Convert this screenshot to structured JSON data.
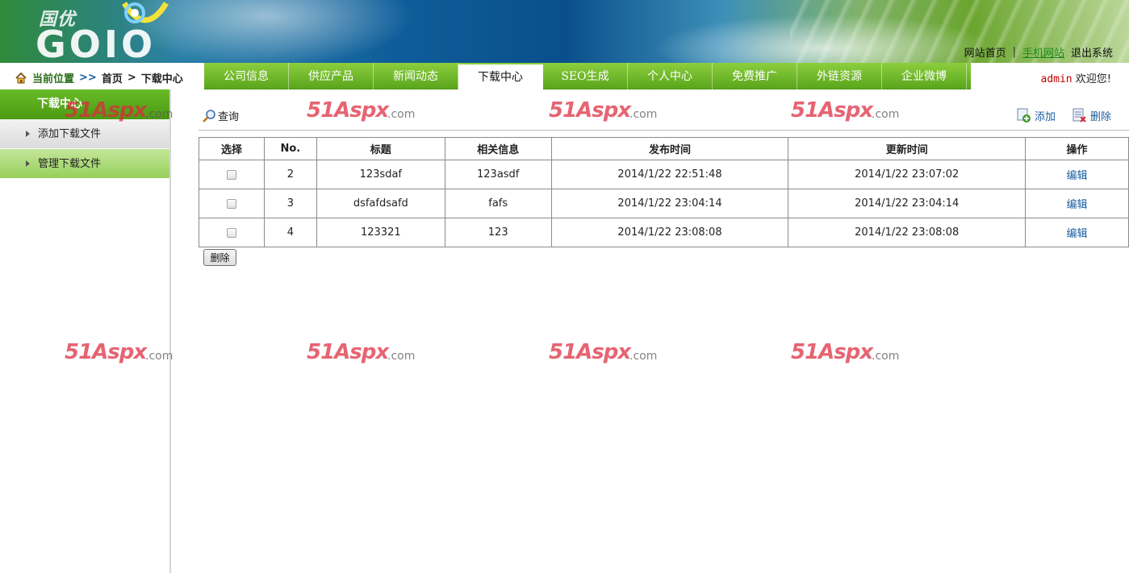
{
  "header": {
    "logo_cn": "国优",
    "logo_en": "GOIO",
    "links": [
      "网站首页",
      "手机网站",
      "退出系统"
    ],
    "separator": "|"
  },
  "breadcrumb": {
    "label": "当前位置",
    "arrow": ">>",
    "home": "首页",
    "sep": ">",
    "current": "下载中心"
  },
  "menu": {
    "items": [
      "公司信息",
      "供应产品",
      "新闻动态",
      "下载中心",
      "SEO生成",
      "个人中心",
      "免费推广",
      "外链资源",
      "企业微博"
    ],
    "active": "下载中心"
  },
  "welcome": {
    "user": "admin",
    "text": "欢迎您!"
  },
  "sidebar": {
    "title": "下载中心",
    "items": [
      "添加下载文件",
      "管理下载文件"
    ]
  },
  "toolbar": {
    "query": "查询",
    "add": "添加",
    "delete": "删除"
  },
  "table": {
    "headers": [
      "选择",
      "No.",
      "标题",
      "相关信息",
      "发布时间",
      "更新时间",
      "操作"
    ],
    "rows": [
      {
        "no": "2",
        "title": "123sdaf",
        "info": "123asdf",
        "published": "2014/1/22 22:51:48",
        "updated": "2014/1/22 23:07:02",
        "action": "编辑"
      },
      {
        "no": "3",
        "title": "dsfafdsafd",
        "info": "fafs",
        "published": "2014/1/22 23:04:14",
        "updated": "2014/1/22 23:04:14",
        "action": "编辑"
      },
      {
        "no": "4",
        "title": "123321",
        "info": "123",
        "published": "2014/1/22 23:08:08",
        "updated": "2014/1/22 23:08:08",
        "action": "编辑"
      }
    ]
  },
  "delete_button": "删除",
  "watermark": {
    "big": "51Aspx",
    "small": ".com"
  },
  "colors": {
    "menu_green": "#5aa51c",
    "link_blue": "#1a5ea0",
    "user_red": "#c00000",
    "mobile_link_green": "#1a8a1a"
  }
}
